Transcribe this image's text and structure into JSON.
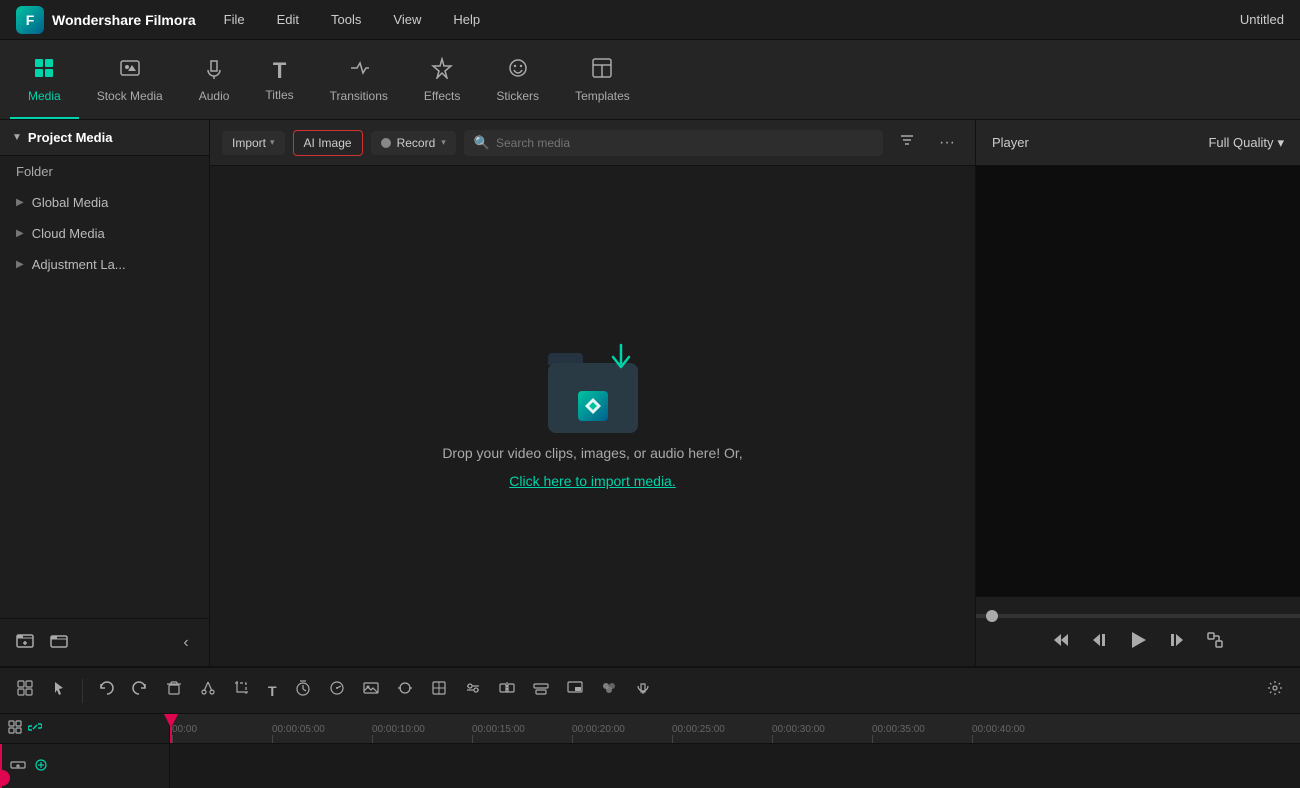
{
  "app": {
    "name": "Wondershare Filmora",
    "title": "Untitled",
    "logo_char": "F"
  },
  "menu": {
    "items": [
      "File",
      "Edit",
      "Tools",
      "View",
      "Help"
    ]
  },
  "toolbar": {
    "tabs": [
      {
        "id": "media",
        "label": "Media",
        "icon": "⊞",
        "active": true
      },
      {
        "id": "stock-media",
        "label": "Stock Media",
        "icon": "🎞"
      },
      {
        "id": "audio",
        "label": "Audio",
        "icon": "♪"
      },
      {
        "id": "titles",
        "label": "Titles",
        "icon": "T"
      },
      {
        "id": "transitions",
        "label": "Transitions",
        "icon": "↔"
      },
      {
        "id": "effects",
        "label": "Effects",
        "icon": "✦"
      },
      {
        "id": "stickers",
        "label": "Stickers",
        "icon": "◉"
      },
      {
        "id": "templates",
        "label": "Templates",
        "icon": "▦"
      }
    ]
  },
  "sidebar": {
    "project_media_label": "Project Media",
    "folder_label": "Folder",
    "items": [
      {
        "label": "Global Media"
      },
      {
        "label": "Cloud Media"
      },
      {
        "label": "Adjustment La..."
      }
    ],
    "footer_buttons": [
      "add-folder",
      "folder"
    ]
  },
  "media_toolbar": {
    "import_label": "Import",
    "ai_image_label": "AI Image",
    "record_label": "Record",
    "search_placeholder": "Search media"
  },
  "drop_area": {
    "drop_text": "Drop your video clips, images, or audio here! Or,",
    "import_link": "Click here to import media."
  },
  "player": {
    "label": "Player",
    "quality": "Full Quality",
    "quality_arrow": "▾"
  },
  "timeline": {
    "ruler_marks": [
      "00:00",
      "00:00:05:00",
      "00:00:10:00",
      "00:00:15:00",
      "00:00:20:00",
      "00:00:25:00",
      "00:00:30:00",
      "00:00:35:00",
      "00:00:40:00",
      "00:00"
    ]
  },
  "icons": {
    "search": "🔍",
    "filter": "⚙",
    "more": "···",
    "arrow_right": "▶",
    "arrow_left": "◀",
    "arrow_down": "▾",
    "collapse": "‹",
    "play": "▶",
    "rewind": "⏮",
    "step_back": "⏪",
    "step_forward": "⏩",
    "fullscreen": "⛶"
  }
}
